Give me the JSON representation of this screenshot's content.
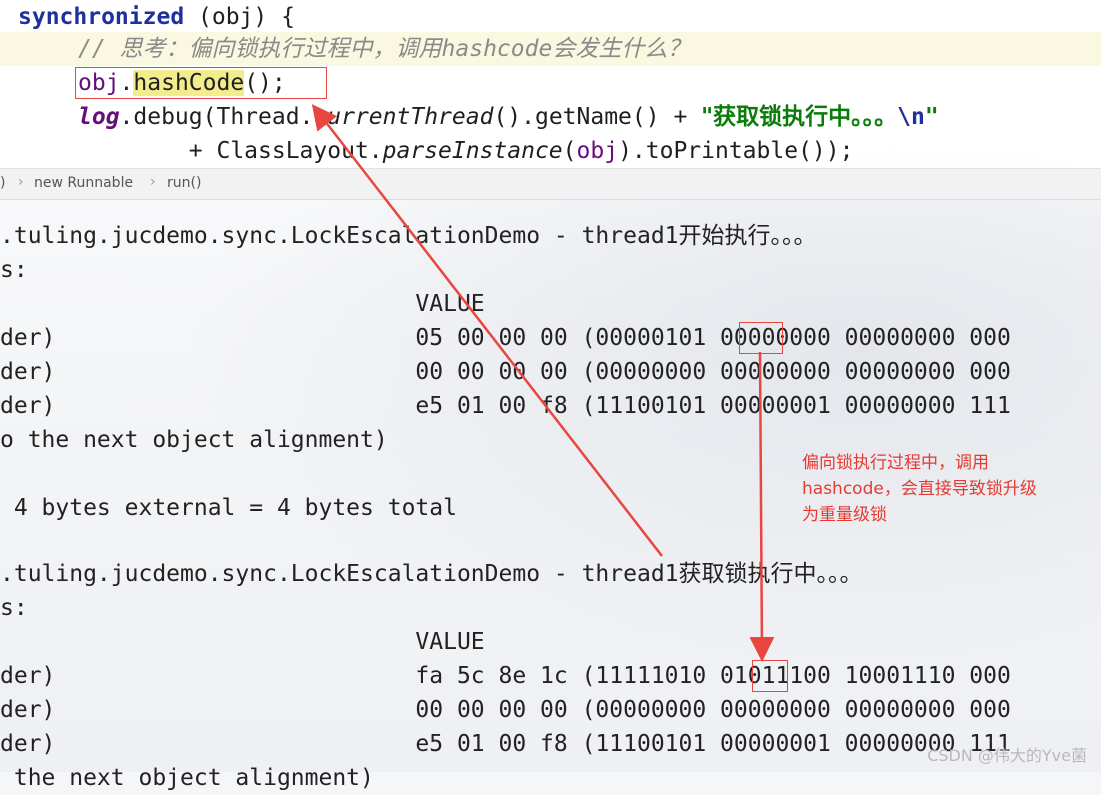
{
  "code": {
    "line1": {
      "kw": "synchronized",
      "rest": " (obj) {"
    },
    "line2": {
      "comment": "// 思考：偏向锁执行过程中，调用hashcode会发生什么？"
    },
    "line3": {
      "obj": "obj",
      "dot": ".",
      "method": "hashCode",
      "end": "();"
    },
    "line4": {
      "log": "log",
      "a": ".debug(Thread.",
      "current": "currentThread",
      "b": "().getName() + ",
      "str": "\"获取锁执行中。。。",
      "esc": "\\n",
      "quote": "\""
    },
    "line5": {
      "a": "        + ClassLayout.",
      "parse": "parseInstance",
      "b": "(",
      "obj": "obj",
      "c": ").toPrintable());"
    }
  },
  "breadcrumbs": {
    "lead": ")",
    "item1": "new Runnable",
    "item2": "run()"
  },
  "console": {
    "lines": [
      {
        "text": ".tuling.jucdemo.sync.LockEscalationDemo - thread1",
        "cn": "开始执行。。。"
      },
      {
        "text": "s:",
        "cn": ""
      },
      {
        "text": "                              VALUE",
        "cn": ""
      },
      {
        "text": "der)                          05 00 00 00 (00000101 00000000 00000000 000",
        "cn": ""
      },
      {
        "text": "der)                          00 00 00 00 (00000000 00000000 00000000 000",
        "cn": ""
      },
      {
        "text": "der)                          e5 01 00 f8 (11100101 00000001 00000000 111",
        "cn": ""
      },
      {
        "text": "o the next object alignment)",
        "cn": ""
      },
      {
        "text": "",
        "cn": ""
      },
      {
        "text": " 4 bytes external = 4 bytes total",
        "cn": ""
      },
      {
        "text": "",
        "cn": ""
      },
      {
        "text": ".tuling.jucdemo.sync.LockEscalationDemo - thread1",
        "cn": "获取锁执行中。。。"
      },
      {
        "text": "s:",
        "cn": ""
      },
      {
        "text": "                              VALUE",
        "cn": ""
      },
      {
        "text": "der)                          fa 5c 8e 1c (11111010 01011100 10001110 000",
        "cn": ""
      },
      {
        "text": "der)                          00 00 00 00 (00000000 00000000 00000000 000",
        "cn": ""
      },
      {
        "text": "der)                          e5 01 00 f8 (11100101 00000001 00000000 111",
        "cn": ""
      },
      {
        "text": " the next object alignment)",
        "cn": ""
      }
    ]
  },
  "annotation": {
    "line1": "偏向锁执行过程中，调用",
    "line2": "hashcode，会直接导致锁升级",
    "line3": "为重量级锁"
  },
  "watermark": "CSDN @伟大的Yve菌",
  "colors": {
    "accent": "#e8473f",
    "keyword": "#1e2f9e",
    "string": "#0a7c0a"
  }
}
